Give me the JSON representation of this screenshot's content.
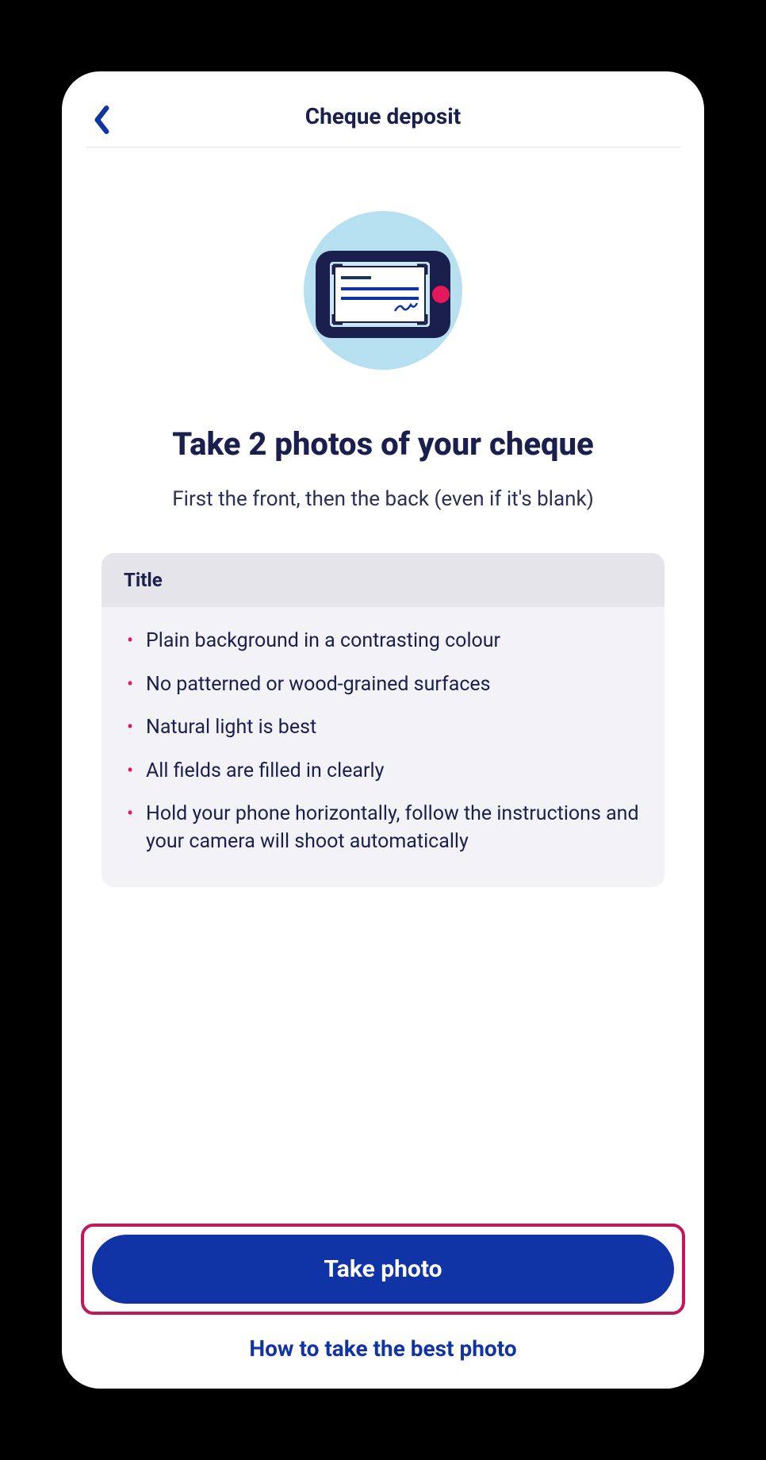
{
  "header": {
    "title": "Cheque deposit"
  },
  "main": {
    "heading": "Take 2 photos of your cheque",
    "subheading": "First the front, then the back (even if it's blank)"
  },
  "tips": {
    "title": "Title",
    "items": [
      "Plain background in a contrasting colour",
      "No patterned or wood-grained surfaces",
      "Natural light is best",
      "All fields are filled in clearly",
      "Hold your phone horizontally, follow the instructions and your camera will shoot automatically"
    ]
  },
  "actions": {
    "primary": "Take photo",
    "secondary": "How to take the best photo"
  },
  "icons": {
    "back": "back-chevron-icon",
    "illustration": "phone-cheque-scan-illustration"
  }
}
